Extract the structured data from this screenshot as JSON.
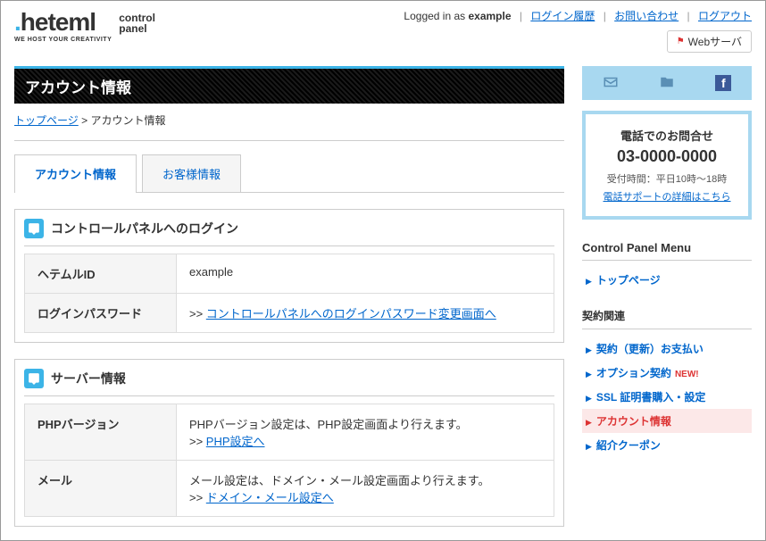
{
  "header": {
    "logged_in_prefix": "Logged in as ",
    "username": "example",
    "links": {
      "history": "ログイン履歴",
      "contact": "お問い合わせ",
      "logout": "ログアウト"
    },
    "server_label": "Webサーバ"
  },
  "logo": {
    "text": ".heteml",
    "tagline": "WE HOST YOUR CREATIVITY",
    "sub1": "control",
    "sub2": "panel"
  },
  "page": {
    "title": "アカウント情報",
    "breadcrumb": {
      "top": "トップページ",
      "sep": " > ",
      "current": "アカウント情報"
    }
  },
  "tabs": [
    {
      "label": "アカウント情報",
      "active": true
    },
    {
      "label": "お客様情報",
      "active": false
    }
  ],
  "sections": [
    {
      "title": "コントロールパネルへのログイン",
      "rows": [
        {
          "label": "ヘテムルID",
          "text": "example",
          "link": null,
          "prefix": ""
        },
        {
          "label": "ログインパスワード",
          "text": "",
          "prefix": ">> ",
          "link": "コントロールパネルへのログインパスワード変更画面へ"
        }
      ]
    },
    {
      "title": "サーバー情報",
      "rows": [
        {
          "label": "PHPバージョン",
          "text": "PHPバージョン設定は、PHP設定画面より行えます。",
          "prefix": ">> ",
          "link": "PHP設定へ"
        },
        {
          "label": "メール",
          "text": "メール設定は、ドメイン・メール設定画面より行えます。",
          "prefix": ">> ",
          "link": "ドメイン・メール設定へ"
        }
      ]
    }
  ],
  "sidebar": {
    "phone": {
      "title": "電話でのお問合せ",
      "number": "03-0000-0000",
      "hours": "受付時間：平日10時〜18時",
      "detail_link": "電話サポートの詳細はこちら"
    },
    "menu_title": "Control Panel Menu",
    "top_item": "トップページ",
    "contract_title": "契約関連",
    "contract_items": [
      {
        "label": "契約（更新）お支払い",
        "active": false,
        "new": false
      },
      {
        "label": "オプション契約",
        "active": false,
        "new": true
      },
      {
        "label": "SSL 証明書購入・設定",
        "active": false,
        "new": false
      },
      {
        "label": "アカウント情報",
        "active": true,
        "new": false
      },
      {
        "label": "紹介クーポン",
        "active": false,
        "new": false
      }
    ],
    "new_text": "NEW!"
  }
}
